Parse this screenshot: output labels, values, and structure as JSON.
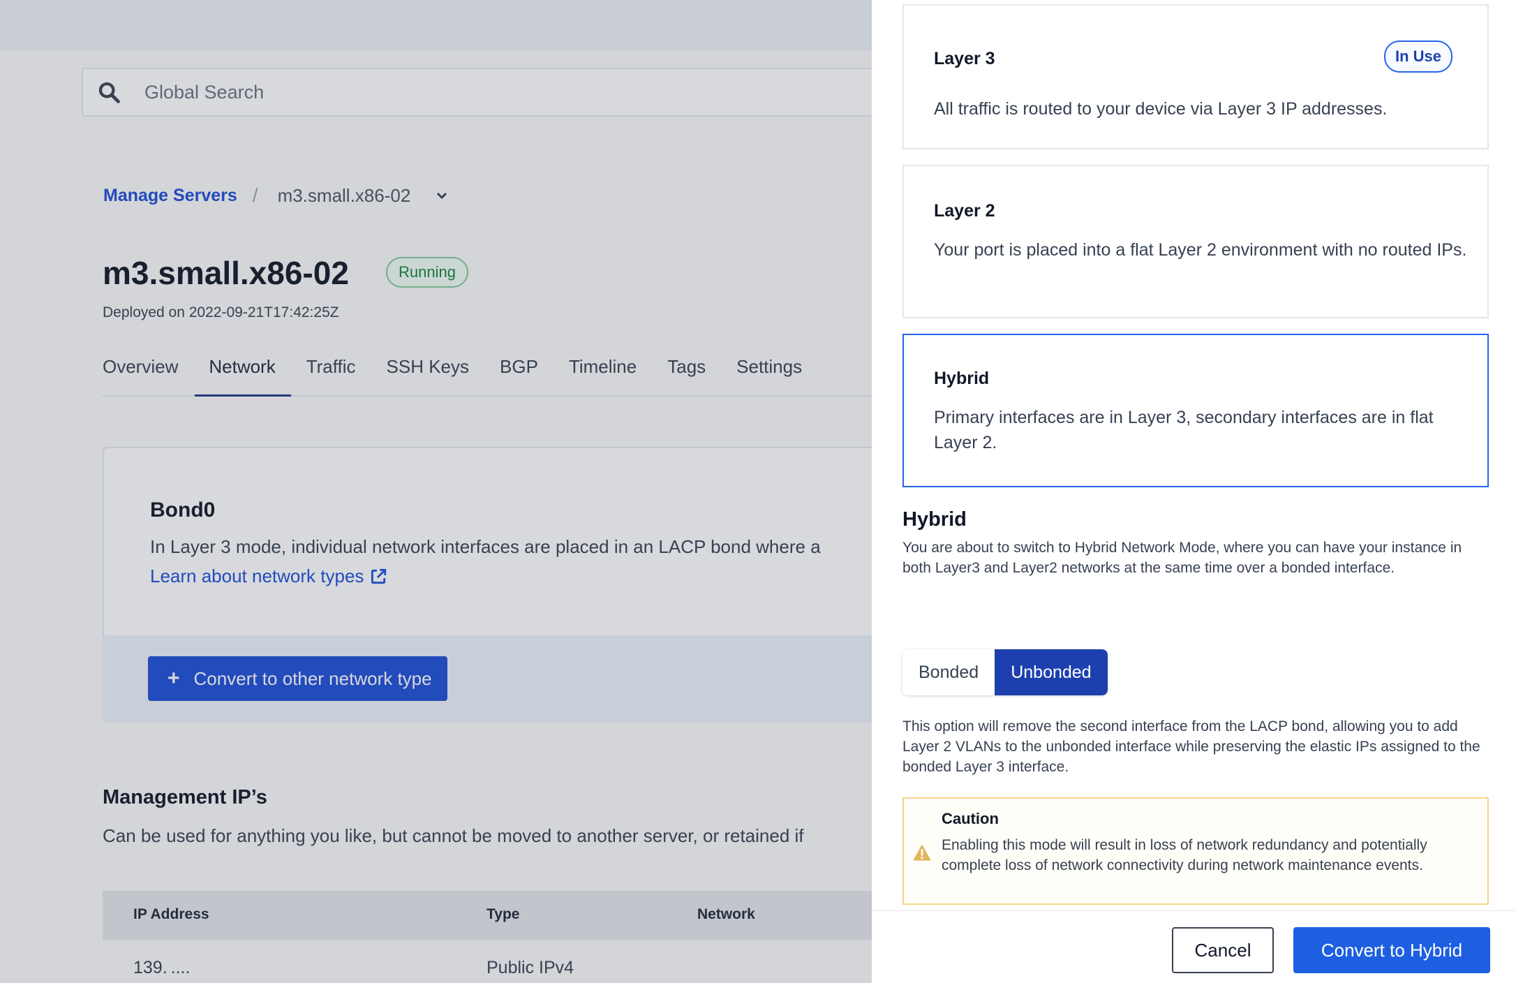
{
  "search": {
    "placeholder": "Global Search"
  },
  "breadcrumb": {
    "parent": "Manage Servers",
    "separator": "/",
    "current": "m3.small.x86-02"
  },
  "server": {
    "name": "m3.small.x86-02",
    "status": "Running",
    "deployed": "Deployed on 2022-09-21T17:42:25Z"
  },
  "tabs": [
    "Overview",
    "Network",
    "Traffic",
    "SSH Keys",
    "BGP",
    "Timeline",
    "Tags",
    "Settings"
  ],
  "bond": {
    "title": "Bond0",
    "description": "In Layer 3 mode, individual network interfaces are placed in an LACP bond where a",
    "link": "Learn about network types",
    "convert_label": "Convert to other network type"
  },
  "management": {
    "title": "Management IP’s",
    "description": "Can be used for anything you like, but cannot be moved to another server, or retained if",
    "columns": [
      "IP Address",
      "Type",
      "Network"
    ],
    "rows": [
      {
        "ip": "139. ....",
        "type": "Public IPv4"
      }
    ]
  },
  "drawer": {
    "options": [
      {
        "title": "Layer 3",
        "description": "All traffic is routed to your device via Layer 3 IP addresses.",
        "badge": "In Use"
      },
      {
        "title": "Layer 2",
        "description": "Your port is placed into a flat Layer 2 environment with no routed IPs."
      },
      {
        "title": "Hybrid",
        "description": "Primary interfaces are in Layer 3, secondary interfaces are in flat Layer 2."
      }
    ],
    "hybrid": {
      "title": "Hybrid",
      "description": "You are about to switch to Hybrid Network Mode, where you can have your instance in both Layer3 and Layer2 networks at the same time over a bonded interface.",
      "toggle": {
        "bonded": "Bonded",
        "unbonded": "Unbonded"
      },
      "selected_mode": "Unbonded",
      "note": "This option will remove the second interface from the LACP bond, allowing you to add Layer 2 VLANs to the unbonded interface while preserving the elastic IPs assigned to the bonded Layer 3 interface."
    },
    "caution": {
      "title": "Caution",
      "text": "Enabling this mode will result in loss of network redundancy and potentially complete loss of network connectivity during network maintenance events."
    },
    "cancel_label": "Cancel",
    "confirm_label": "Convert to Hybrid"
  },
  "colors": {
    "primary": "#1d4ed8",
    "selected_border": "#2563eb",
    "running": "#15803d",
    "caution_border": "#f5d48a"
  }
}
